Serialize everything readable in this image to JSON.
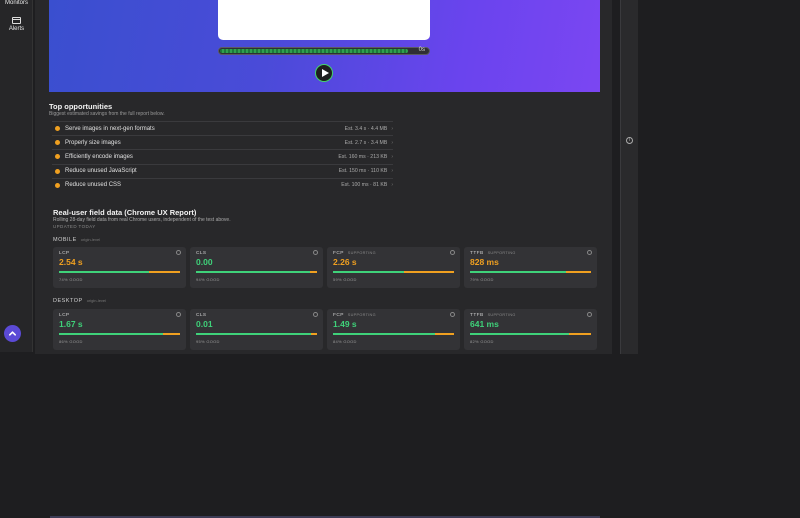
{
  "nav": {
    "monitors_label": "Monitors",
    "alerts_label": "Alerts"
  },
  "hero": {
    "time_label": "0s",
    "progress_fraction": 1.0
  },
  "opportunities": {
    "title": "Top opportunities",
    "subtitle": "Biggest estimated savings from the full report below.",
    "items": [
      {
        "label": "Serve images in next-gen formats",
        "est": "Est. 3.4 s · 4.4 MB"
      },
      {
        "label": "Properly size images",
        "est": "Est. 2.7 s · 3.4 MB"
      },
      {
        "label": "Efficiently encode images",
        "est": "Est. 160 ms · 213 KB"
      },
      {
        "label": "Reduce unused JavaScript",
        "est": "Est. 150 ms · 110 KB"
      },
      {
        "label": "Reduce unused CSS",
        "est": "Est. 100 ms · 81 KB"
      }
    ]
  },
  "field": {
    "title": "Real-user field data (Chrome UX Report)",
    "subtitle": "Rolling 28-day field data from real Chrome users, independent of the test above.",
    "updated": "UPDATED TODAY",
    "mobile": {
      "label": "MOBILE",
      "tag": "origin-level",
      "cards": [
        {
          "metric": "LCP",
          "tag": "",
          "value": "2.54 s",
          "good": "74% GOOD",
          "good_fraction": 0.74,
          "status": "orange"
        },
        {
          "metric": "CLS",
          "tag": "",
          "value": "0.00",
          "good": "94% GOOD",
          "good_fraction": 0.94,
          "status": "green"
        },
        {
          "metric": "FCP",
          "tag": "SUPPORTING",
          "value": "2.26 s",
          "good": "59% GOOD",
          "good_fraction": 0.59,
          "status": "orange"
        },
        {
          "metric": "TTFB",
          "tag": "SUPPORTING",
          "value": "828 ms",
          "good": "79% GOOD",
          "good_fraction": 0.79,
          "status": "orange"
        }
      ]
    },
    "desktop": {
      "label": "DESKTOP",
      "tag": "origin-level",
      "cards": [
        {
          "metric": "LCP",
          "tag": "",
          "value": "1.67 s",
          "good": "86% GOOD",
          "good_fraction": 0.86,
          "status": "green"
        },
        {
          "metric": "CLS",
          "tag": "",
          "value": "0.01",
          "good": "95% GOOD",
          "good_fraction": 0.95,
          "status": "green"
        },
        {
          "metric": "FCP",
          "tag": "SUPPORTING",
          "value": "1.49 s",
          "good": "84% GOOD",
          "good_fraction": 0.84,
          "status": "green"
        },
        {
          "metric": "TTFB",
          "tag": "SUPPORTING",
          "value": "641 ms",
          "good": "82% GOOD",
          "good_fraction": 0.82,
          "status": "green"
        }
      ]
    }
  },
  "colors": {
    "accent": "#5b4ad6",
    "good": "#3fd27a",
    "needs_improvement": "#f0a020"
  },
  "icons": {
    "nav_alerts": "card-icon",
    "fab": "chevron-up-icon",
    "play": "play-icon",
    "info": "info-icon"
  }
}
